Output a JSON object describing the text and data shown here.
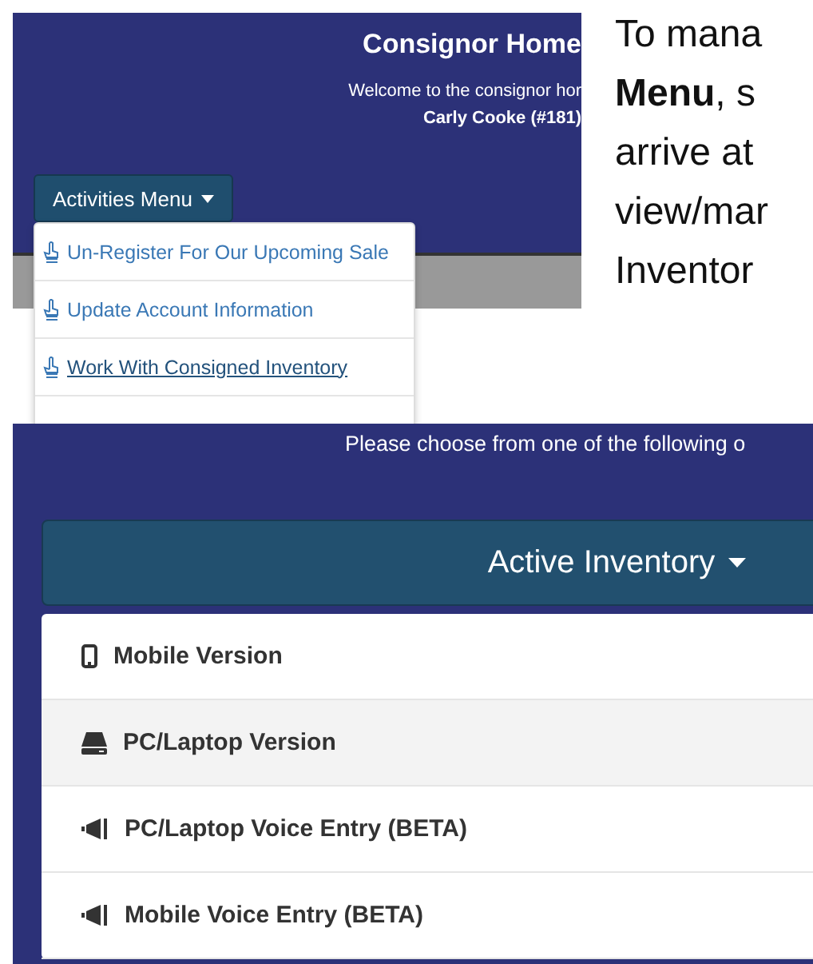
{
  "top_screenshot": {
    "title": "Consignor Home",
    "welcome": "Welcome to the consignor hor",
    "user": "Carly Cooke (#181)",
    "menu_button": "Activities Menu",
    "menu_items": [
      {
        "label": "Un-Register For Our Upcoming Sale",
        "selected": false
      },
      {
        "label": "Update Account Information",
        "selected": false
      },
      {
        "label": "Work With Consigned Inventory",
        "selected": true
      }
    ]
  },
  "instructions": {
    "lines": [
      "To mana",
      "**Menu**, s",
      "arrive at",
      "view/mar",
      "Inventor"
    ]
  },
  "bottom_screenshot": {
    "prompt": "Please choose from one of the following o",
    "dropdown_button": "Active Inventory",
    "options": [
      {
        "label": "Mobile Version",
        "kind": "mobile",
        "selected": false
      },
      {
        "label": "PC/Laptop Version",
        "kind": "laptop",
        "selected": true
      },
      {
        "label": "PC/Laptop Voice Entry (BETA)",
        "kind": "voice",
        "selected": false
      },
      {
        "label": "Mobile Voice Entry (BETA)",
        "kind": "voice",
        "selected": false
      }
    ]
  }
}
